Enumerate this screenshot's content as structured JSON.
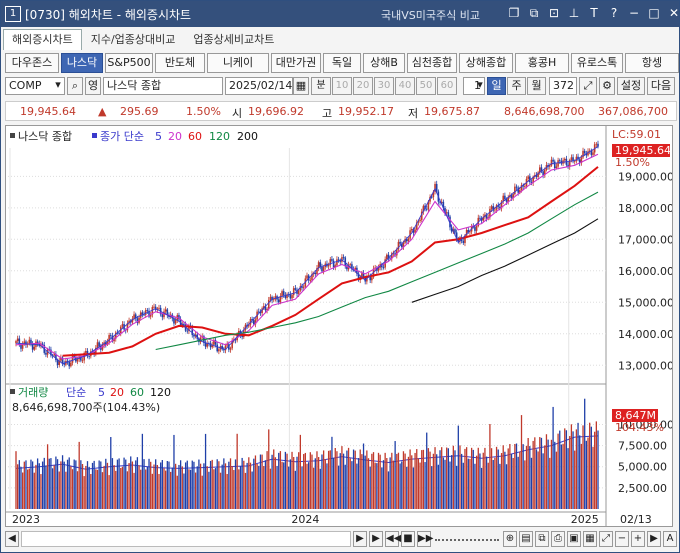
{
  "window": {
    "number": "1",
    "title": "[0730] 해외차트 - 해외증시차트",
    "subtitle": "국내VS미국주식 비교",
    "icons": [
      "restore-icon",
      "link-icon",
      "dock-icon",
      "pin-icon",
      "text-icon",
      "help-icon",
      "minimize-icon",
      "maximize-icon",
      "close-icon"
    ]
  },
  "tabs": [
    "해외증시차트",
    "지수/업종상대비교",
    "업종상세비교차트"
  ],
  "markets": [
    "다우존스",
    "나스닥",
    "S&P500",
    "반도체",
    "니케이",
    "대만가권",
    "독일",
    "상해B",
    "심천종합",
    "상해종합",
    "홍콩H",
    "유로스톡",
    "항셍"
  ],
  "selected_market_index": 1,
  "toolbar": {
    "code": "COMP",
    "eng_toggle": "영",
    "name": "나스닥 종합",
    "date": "2025/02/14",
    "period_buttons": [
      "분",
      "10",
      "20",
      "30",
      "40",
      "50",
      "60"
    ],
    "count_value": "1",
    "day_buttons": [
      "일",
      "주",
      "월"
    ],
    "selected_day": "일",
    "bars": "372",
    "settings": "설정",
    "next": "다음"
  },
  "quote": {
    "price": "19,945.64",
    "arrow": "▲",
    "change": "295.69",
    "pct": "1.50%",
    "open_label": "시",
    "open": "19,696.92",
    "high_label": "고",
    "high": "19,952.17",
    "low_label": "저",
    "low": "19,675.87",
    "volume": "8,646,698,700",
    "amount": "367,086,700"
  },
  "price_pane": {
    "legend_name": "나스닥 종합",
    "legend_ma_label": "종가 단순",
    "ma_periods": [
      "5",
      "20",
      "60",
      "120",
      "200"
    ],
    "lc_label": "LC:59.01",
    "current_price": "19,945.64",
    "current_pct": "1.50%",
    "y_ticks": [
      "19,000.00",
      "18,000.00",
      "17,000.00",
      "16,000.00",
      "15,000.00",
      "14,000.00",
      "13,000.00"
    ]
  },
  "volume_pane": {
    "legend_name": "거래량",
    "legend_ma_label": "단순",
    "ma_periods": [
      "5",
      "20",
      "60",
      "120"
    ],
    "info": "8,646,698,700주(104.43%)",
    "current_volume": "8,647M",
    "current_pct": "104.43%",
    "y_ticks": [
      "10,000.00",
      "7,500.00",
      "5,000.00",
      "2,500.00"
    ]
  },
  "x_axis": {
    "labels": [
      "2023",
      "2024",
      "2025"
    ],
    "last_date": "02/13"
  },
  "colors": {
    "up": "#c0392b",
    "down": "#1f3fa8",
    "ma5": "#3a3acc",
    "ma20": "#cc33cc",
    "ma60": "#dd1111",
    "ma120": "#118844",
    "ma200": "#111111",
    "accent": "#3e66b3"
  },
  "chart_data": {
    "type": "line",
    "title": "나스닥 종합",
    "x": [
      "2023-01",
      "2023-02",
      "2023-03",
      "2023-04",
      "2023-05",
      "2023-06",
      "2023-07",
      "2023-08",
      "2023-09",
      "2023-10",
      "2023-11",
      "2023-12",
      "2024-01",
      "2024-02",
      "2024-03",
      "2024-04",
      "2024-05",
      "2024-06",
      "2024-07",
      "2024-08",
      "2024-09",
      "2024-10",
      "2024-11",
      "2024-12",
      "2025-01",
      "2025-02"
    ],
    "series": [
      {
        "name": "나스닥 종합",
        "values": [
          13700,
          13650,
          13050,
          13300,
          13800,
          14450,
          14800,
          14400,
          13750,
          13500,
          14300,
          15100,
          15300,
          16100,
          16350,
          15700,
          16400,
          17200,
          18600,
          16900,
          17650,
          18250,
          18850,
          19400,
          19500,
          19945.64
        ]
      },
      {
        "name": "20",
        "values": [
          13650,
          13700,
          13200,
          13300,
          13700,
          14300,
          14700,
          14500,
          13900,
          13650,
          14100,
          14900,
          15100,
          15900,
          16200,
          15900,
          16300,
          17000,
          18200,
          17300,
          17500,
          18100,
          18700,
          19200,
          19350,
          19700
        ]
      },
      {
        "name": "60",
        "values": [
          null,
          null,
          13300,
          13350,
          13400,
          13600,
          14000,
          14250,
          14200,
          14000,
          13950,
          14250,
          14600,
          15100,
          15600,
          15800,
          15950,
          16300,
          16900,
          17000,
          17200,
          17450,
          17700,
          18200,
          18700,
          19300
        ]
      },
      {
        "name": "120",
        "values": [
          null,
          null,
          null,
          null,
          null,
          null,
          13500,
          13650,
          13800,
          13950,
          14050,
          14200,
          14350,
          14550,
          14850,
          15150,
          15350,
          15650,
          15950,
          16250,
          16550,
          16850,
          17200,
          17650,
          18100,
          18500
        ]
      },
      {
        "name": "200",
        "values": [
          null,
          null,
          null,
          null,
          null,
          null,
          null,
          null,
          null,
          null,
          null,
          null,
          null,
          null,
          null,
          null,
          null,
          15000,
          15250,
          15500,
          15850,
          16150,
          16500,
          16850,
          17200,
          17650
        ]
      }
    ],
    "volume": {
      "name": "거래량",
      "unit": "M",
      "values": [
        4800,
        5000,
        5300,
        4700,
        5000,
        5200,
        4900,
        4800,
        4900,
        5000,
        5100,
        5900,
        5600,
        5700,
        6200,
        5800,
        5500,
        5900,
        6100,
        6300,
        6000,
        6300,
        7000,
        7500,
        8500,
        8647
      ]
    },
    "ylim": [
      12500,
      19900
    ],
    "volume_ylim": [
      0,
      11000
    ]
  }
}
